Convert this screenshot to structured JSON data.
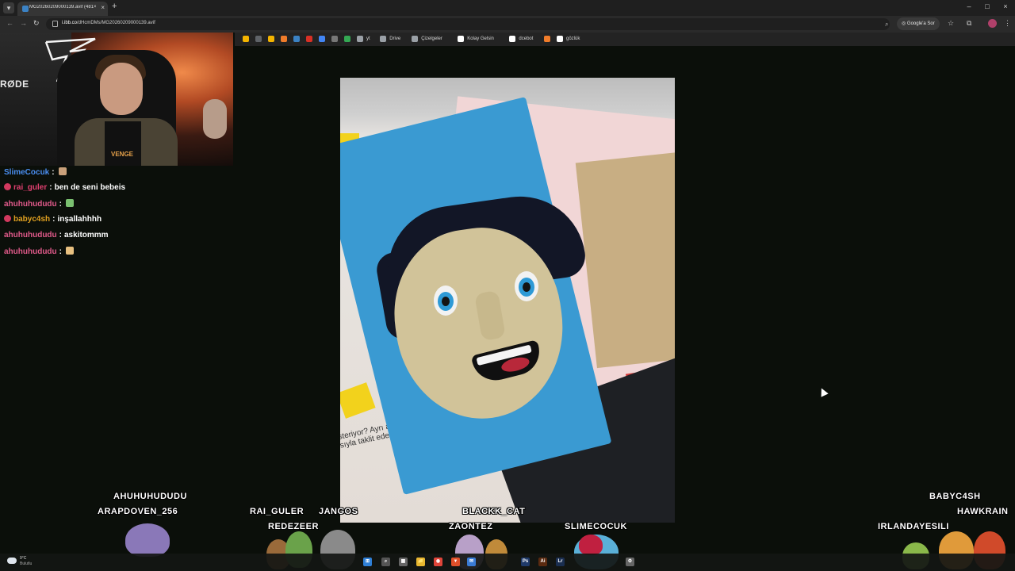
{
  "browser": {
    "tab_title": "MG20260209000139.avif (481×",
    "tab_close": "×",
    "new_tab": "+",
    "url_host": "i.ibb.co",
    "url_path": "/dHcmDMs/MG20260209000139.avif",
    "lens_label": "Google'a Sor",
    "window_controls": [
      "–",
      "□",
      "×"
    ]
  },
  "bookmarks": [
    {
      "color": "#f4b400",
      "label": ""
    },
    {
      "color": "#5f6368",
      "label": ""
    },
    {
      "color": "#f4b400",
      "label": ""
    },
    {
      "color": "#f07c2a",
      "label": ""
    },
    {
      "color": "#3b82c4",
      "label": ""
    },
    {
      "color": "#d93025",
      "label": ""
    },
    {
      "color": "#4285f4",
      "label": ""
    },
    {
      "color": "#777777",
      "label": ""
    },
    {
      "color": "#34a853",
      "label": ""
    },
    {
      "color": "#9aa0a6",
      "label": "yt"
    },
    {
      "color": "#9aa0a6",
      "label": "Drive"
    },
    {
      "color": "#9aa0a6",
      "label": "Çizelgeler"
    },
    {
      "color": "#ffffff",
      "label": "Kolay Gelsin"
    },
    {
      "color": "#ffffff",
      "label": "dcebot"
    },
    {
      "color": "#f07c2a",
      "label": ""
    },
    {
      "color": "#ffffff",
      "label": "gözlük"
    }
  ],
  "webcam": {
    "brand_text": "RØDE",
    "shirt_text": "VENGE"
  },
  "chat": [
    {
      "user": "SlimeCocuk",
      "color": "#4a8ef0",
      "badge": false,
      "text": "",
      "emote": "#c9a07a"
    },
    {
      "user": "rai_guler",
      "color": "#e04070",
      "badge": true,
      "text": "ben de seni bebeis",
      "emote": ""
    },
    {
      "user": "ahuhuhududu",
      "color": "#e05a8a",
      "badge": false,
      "text": "",
      "emote": "#7ac070"
    },
    {
      "user": "babyc4sh",
      "color": "#e0a020",
      "badge": true,
      "text": "inşallahhhh",
      "emote": ""
    },
    {
      "user": "ahuhuhududu",
      "color": "#e05a8a",
      "badge": false,
      "text": "askitommm",
      "emote": ""
    },
    {
      "user": "ahuhuhududu",
      "color": "#e05a8a",
      "badge": false,
      "text": "",
      "emote": "#e8c080"
    }
  ],
  "chat_separator": ":",
  "photo_text": "steriyor? Ayrı ay\nsıyla taklit edelim",
  "viewers": [
    "AHUHUHUDUDU",
    "ARAPDOVEN_256",
    "RAI_GULER",
    "JANGOS",
    "REDEZEER",
    "BLACKK_CAT",
    "ZAONTEZ",
    "SLIMECOCUK",
    "BABYC4SH",
    "HAWKRAIN",
    "IRLANDAYESILI"
  ],
  "taskbar": {
    "weather_temp": "9°C",
    "weather_desc": "Bulutlu",
    "apps": [
      {
        "label": "⊞",
        "color": "#2f7fd6"
      },
      {
        "label": "⌕",
        "color": "#555555"
      },
      {
        "label": "▦",
        "color": "#666666"
      },
      {
        "label": "📁",
        "color": "#e8b830"
      },
      {
        "label": "◉",
        "color": "#e0453a"
      },
      {
        "label": "▼",
        "color": "#e0502a"
      },
      {
        "label": "✉",
        "color": "#3a7bd5"
      },
      {
        "label": "Ps",
        "color": "#1f3a6a"
      },
      {
        "label": "Ai",
        "color": "#5a2a10"
      },
      {
        "label": "Lr",
        "color": "#1a2e50"
      },
      {
        "label": "⚙",
        "color": "#666666"
      }
    ]
  }
}
